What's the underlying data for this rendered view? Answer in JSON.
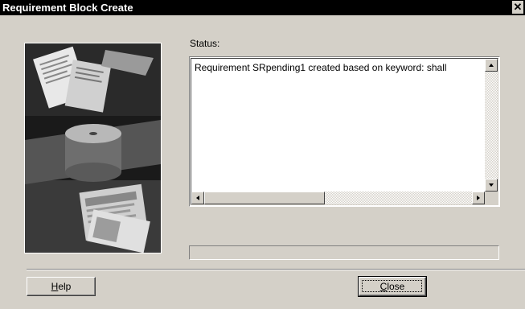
{
  "window": {
    "title": "Requirement Block Create",
    "close_glyph": "✕"
  },
  "status": {
    "label": "Status:",
    "text": "Requirement SRpending1 created based on keyword: shall"
  },
  "progress": {
    "value": 0
  },
  "buttons": {
    "help": {
      "mnemonic": "H",
      "rest": "elp"
    },
    "close": {
      "mnemonic": "C",
      "rest": "lose"
    }
  },
  "icons": {
    "close": "close-icon",
    "up": "arrow-up-icon",
    "down": "arrow-down-icon",
    "left": "arrow-left-icon",
    "right": "arrow-right-icon"
  },
  "colors": {
    "titlebar": "#000000",
    "title_text": "#ffffff",
    "face": "#d4d0c8"
  }
}
